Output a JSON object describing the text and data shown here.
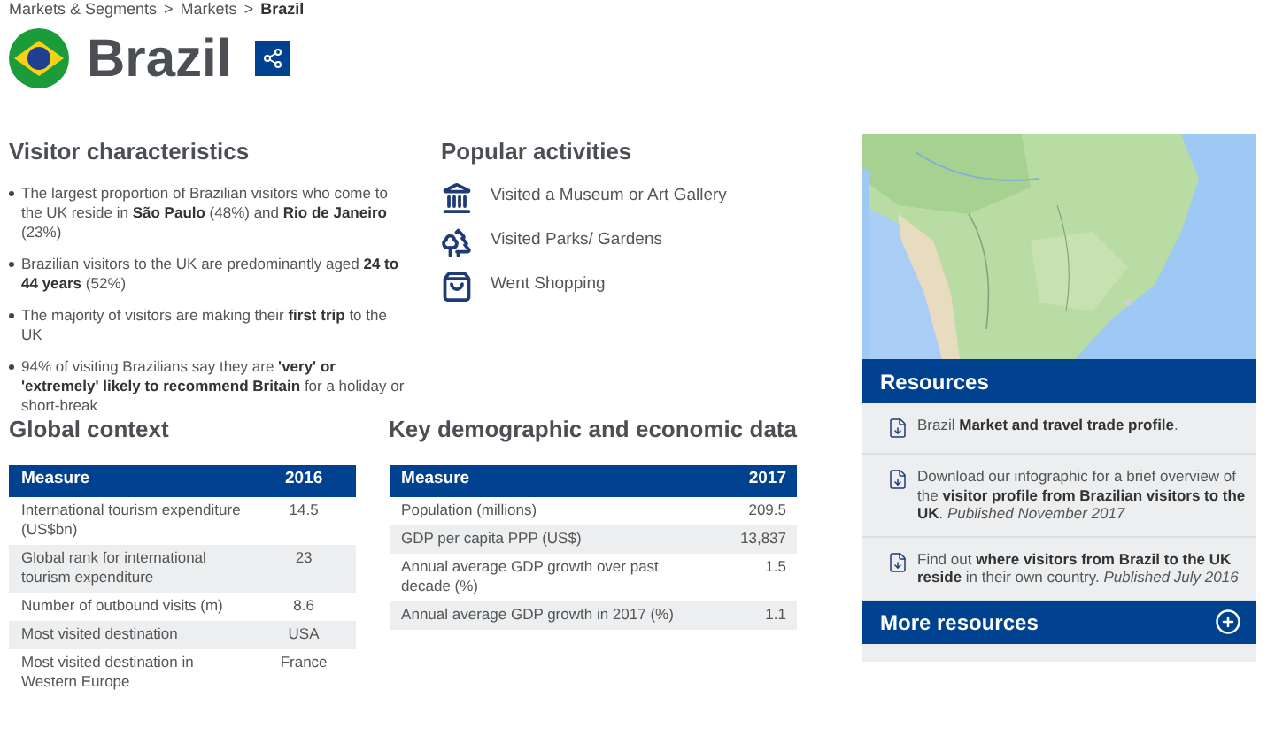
{
  "breadcrumb": [
    {
      "label": "Markets & Segments",
      "current": false
    },
    {
      "label": "Markets",
      "current": false
    },
    {
      "label": "Brazil",
      "current": true
    }
  ],
  "breadcrumb_separator": ">",
  "title": "Brazil",
  "visitor_characteristics": {
    "heading": "Visitor characteristics",
    "items": [
      "The largest proportion of Brazilian visitors who come to the UK reside in **São Paulo** (48%) and **Rio de Janeiro** (23%)",
      "Brazilian visitors to the UK are predominantly aged **24 to 44 years** (52%)",
      "The majority of visitors are making their **first trip** to the UK",
      "94% of visiting Brazilians say they are **'very' or 'extremely' likely to recommend Britain** for a holiday or short-break"
    ]
  },
  "popular_activities": {
    "heading": "Popular activities",
    "items": [
      {
        "label": "Visited a Museum or Art Gallery",
        "kind": "museum"
      },
      {
        "label": "Visited Parks/ Gardens",
        "kind": "park"
      },
      {
        "label": "Went Shopping",
        "kind": "shopping"
      }
    ]
  },
  "resources": {
    "heading": "Resources",
    "items": [
      "Brazil **Market and travel trade profile**.",
      "Download our infographic for a brief overview of the **visitor profile from Brazilian visitors to the UK**. *Published November 2017*",
      "Find out **where visitors from Brazil to the UK reside** in their own country. *Published July 2016*"
    ],
    "more": "More resources",
    "more_expanded": false
  },
  "global_context": {
    "heading": "Global context",
    "columns": [
      "Measure",
      "2016"
    ],
    "rows": [
      [
        "International tourism expenditure (US$bn)",
        "14.5"
      ],
      [
        "Global rank for international tourism expenditure",
        "23"
      ],
      [
        "Number of outbound visits (m)",
        "8.6"
      ],
      [
        "Most visited destination",
        "USA"
      ],
      [
        "Most visited destination in Western Europe",
        "France"
      ]
    ]
  },
  "key_data": {
    "heading": "Key demographic and economic data",
    "columns": [
      "Measure",
      "2017"
    ],
    "rows": [
      [
        "Population (millions)",
        "209.5"
      ],
      [
        "GDP per capita PPP (US$)",
        "13,837"
      ],
      [
        "Annual average GDP growth over past decade (%)",
        "1.5"
      ],
      [
        "Annual average GDP growth in 2017 (%)",
        "1.1"
      ]
    ]
  }
}
